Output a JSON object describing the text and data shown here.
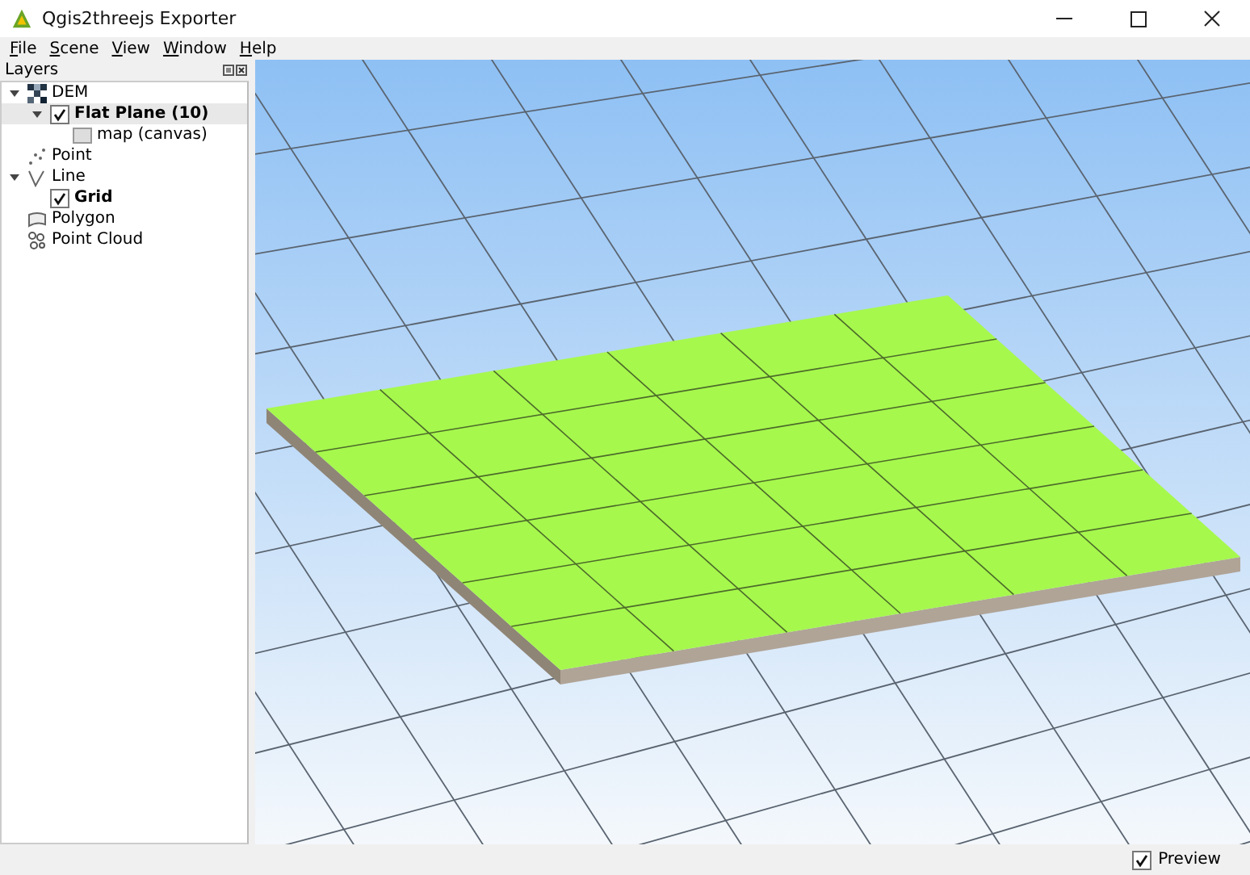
{
  "window": {
    "title": "Qgis2threejs Exporter"
  },
  "menu": [
    "File",
    "Scene",
    "View",
    "Window",
    "Help"
  ],
  "layers_panel": {
    "title": "Layers",
    "items": [
      {
        "label": "DEM",
        "kind": "dem",
        "expanded": true,
        "selected": false,
        "children": [
          {
            "label": "Flat Plane (10)",
            "kind": "layer",
            "checked": true,
            "expanded": true,
            "selected": true,
            "children": [
              {
                "label": "map (canvas)",
                "kind": "texture",
                "selected": false
              }
            ]
          }
        ]
      },
      {
        "label": "Point",
        "kind": "point",
        "selected": false
      },
      {
        "label": "Line",
        "kind": "line",
        "expanded": true,
        "selected": false,
        "children": [
          {
            "label": "Grid",
            "kind": "layer",
            "checked": true,
            "selected": false
          }
        ]
      },
      {
        "label": "Polygon",
        "kind": "polygon",
        "selected": false
      },
      {
        "label": "Point Cloud",
        "kind": "cloud",
        "selected": false
      }
    ]
  },
  "status_bar": {
    "preview": {
      "label": "Preview",
      "checked": true
    }
  }
}
